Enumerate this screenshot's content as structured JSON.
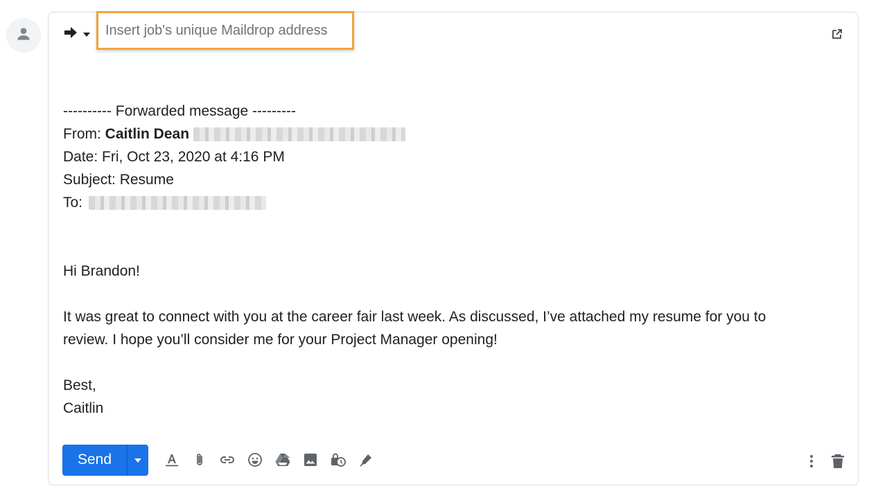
{
  "compose": {
    "recipient_placeholder": "Insert job's unique Maildrop address",
    "forward_header": "---------- Forwarded message ---------",
    "from_label": "From: ",
    "from_name": "Caitlin Dean",
    "date_line": "Date: Fri, Oct 23, 2020 at 4:16 PM",
    "subject_line": "Subject: Resume",
    "to_label": "To: ",
    "greeting": "Hi Brandon!",
    "body_line1": "It was great to connect with you at the career fair last week. As discussed, I’ve attached my resume for you to",
    "body_line2": "review. I hope you’ll consider me for your Project Manager opening!",
    "signoff": "Best,",
    "signature": "Caitlin"
  },
  "toolbar": {
    "send_label": "Send"
  },
  "icons": [
    "person-icon",
    "forward-arrow-icon",
    "dropdown-caret-icon",
    "popout-icon",
    "format-text-icon",
    "attach-icon",
    "link-icon",
    "emoji-icon",
    "drive-icon",
    "photo-icon",
    "confidential-icon",
    "signature-icon",
    "more-vert-icon",
    "trash-icon"
  ],
  "colors": {
    "send_blue": "#1a73e8",
    "highlight_orange": "#f4a23c",
    "icon_gray": "#5f6368"
  }
}
